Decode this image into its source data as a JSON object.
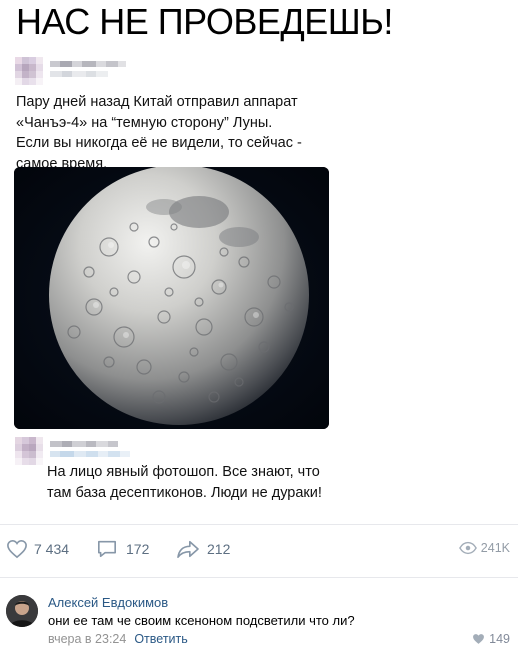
{
  "headline": "НАС НЕ ПРОВЕДЕШЬ!",
  "post": {
    "lines": [
      "Пару дней назад Китай отправил аппарат",
      "«Чанъэ-4» на “темную сторону” Луны.",
      "Если вы никогда её не видели, то сейчас -",
      "самое время."
    ]
  },
  "reply": {
    "lines": [
      "На лицо явный фотошоп. Все знают, что",
      "там база десептиконов. Люди не дураки!"
    ]
  },
  "actions": {
    "likes": "7 434",
    "comments": "172",
    "shares": "212",
    "views": "241K"
  },
  "comment": {
    "author": "Алексей Евдокимов",
    "text": "они ее там че своим ксеноном подсветили что ли?",
    "time": "вчера в 23:24",
    "reply_label": "Ответить",
    "likes": "149"
  },
  "colors": {
    "link": "#2a5885",
    "muted": "#5d6f82",
    "divider": "#e7e8ec"
  }
}
